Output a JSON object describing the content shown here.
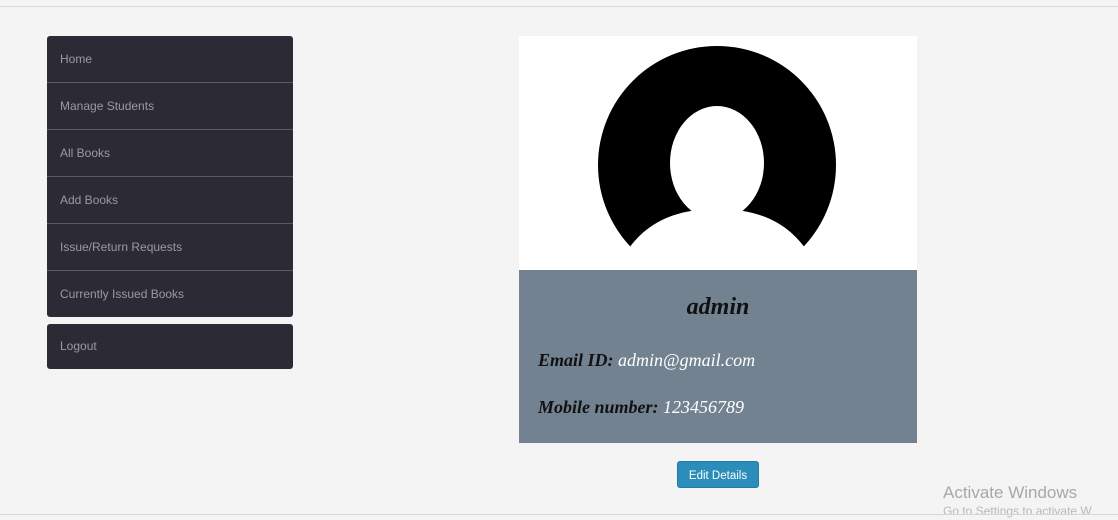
{
  "sidebar": {
    "items": [
      {
        "label": "Home"
      },
      {
        "label": "Manage Students"
      },
      {
        "label": "All Books"
      },
      {
        "label": "Add Books"
      },
      {
        "label": "Issue/Return Requests"
      },
      {
        "label": "Currently Issued Books"
      }
    ],
    "logout_label": "Logout"
  },
  "profile": {
    "avatar_icon": "user-avatar-icon",
    "name": "admin",
    "email_label": "Email ID:",
    "email_value": "admin@gmail.com",
    "mobile_label": "Mobile number:",
    "mobile_value": "123456789",
    "info_bg_color": "#738291"
  },
  "actions": {
    "edit_label": "Edit Details",
    "accent_color": "#2a8dba"
  },
  "watermark": {
    "title": "Activate Windows",
    "subtitle": "Go to Settings to activate W"
  }
}
